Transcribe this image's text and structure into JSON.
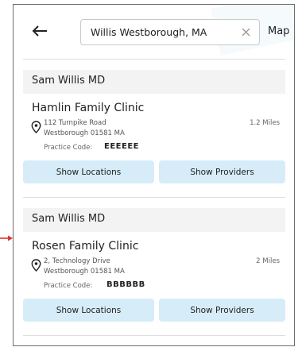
{
  "search": {
    "value": "Willis Westborough, MA"
  },
  "header": {
    "map_label": "Map"
  },
  "results": [
    {
      "doctor": "Sam Willis MD",
      "clinic": "Hamlin Family Clinic",
      "address_line1": "112 Turnpike Road",
      "address_line2": "Westborough 01581 MA",
      "distance": "1.2 Miles",
      "practice_code_label": "Practice Code:",
      "practice_code": "EEEEEE",
      "show_locations": "Show Locations",
      "show_providers": "Show Providers"
    },
    {
      "doctor": "Sam Willis MD",
      "clinic": "Rosen Family Clinic",
      "address_line1": "2, Technology Drive",
      "address_line2": "Westborough 01581 MA",
      "distance": "2 Miles",
      "practice_code_label": "Practice Code:",
      "practice_code": "BBBBBB",
      "show_locations": "Show Locations",
      "show_providers": "Show Providers"
    }
  ],
  "colors": {
    "button_bg": "#d6ecf8",
    "header_bg": "#f3f3f3",
    "arrow": "#e0322c"
  },
  "icons": [
    "back-arrow-icon",
    "clear-icon",
    "location-pin-icon",
    "pointer-arrow-icon"
  ]
}
